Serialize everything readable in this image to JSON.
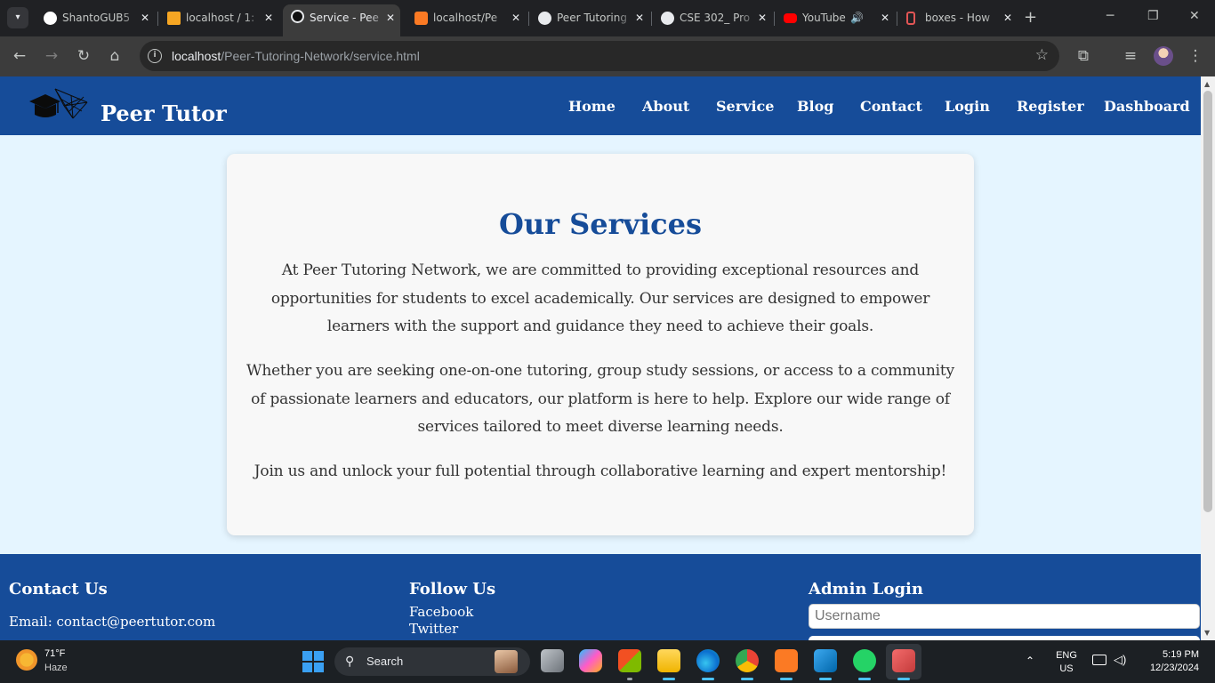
{
  "browser": {
    "tabs": [
      {
        "label": "ShantoGUB5",
        "icon": "github-icon",
        "color": "#ffffff",
        "active": false
      },
      {
        "label": "localhost / 1:",
        "icon": "phpmyadmin-icon",
        "color": "#f6a623",
        "active": false
      },
      {
        "label": "Service - Pee",
        "icon": "service-icon",
        "color": "#e8eaed",
        "active": true
      },
      {
        "label": "localhost/Pe",
        "icon": "xampp-icon",
        "color": "#fb7a24",
        "active": false
      },
      {
        "label": "Peer Tutoring",
        "icon": "openai-icon",
        "color": "#e8eaed",
        "active": false
      },
      {
        "label": "CSE 302_ Pro",
        "icon": "chatgpt-icon",
        "color": "#e8eaed",
        "active": false
      },
      {
        "label": "YouTube",
        "icon": "youtube-icon",
        "color": "#ff0000",
        "active": false
      },
      {
        "label": "boxes - How",
        "icon": "codepen-icon",
        "color": "#e25555",
        "active": false
      }
    ],
    "address": {
      "host": "localhost",
      "path": "/Peer-Tutoring-Network/service.html"
    }
  },
  "site": {
    "brand": "Peer Tutor",
    "nav": [
      "Home",
      "About",
      "Service",
      "Blog",
      "Contact",
      "Login",
      "Register",
      "Dashboard"
    ],
    "accent": "#164c99",
    "background": "#e5f5ff"
  },
  "services": {
    "title": "Our Services",
    "paragraphs": [
      "At Peer Tutoring Network, we are committed to providing exceptional resources and opportunities for students to excel academically. Our services are designed to empower learners with the support and guidance they need to achieve their goals.",
      "Whether you are seeking one-on-one tutoring, group study sessions, or access to a community of passionate learners and educators, our platform is here to help. Explore our wide range of services tailored to meet diverse learning needs.",
      "Join us and unlock your full potential through collaborative learning and expert mentorship!"
    ]
  },
  "footer": {
    "contact_heading": "Contact Us",
    "contact_email": "Email: contact@peertutor.com",
    "follow_heading": "Follow Us",
    "follow_links": [
      "Facebook",
      "Twitter"
    ],
    "admin_heading": "Admin Login",
    "username_placeholder": "Username"
  },
  "taskbar": {
    "weather_temp": "71°F",
    "weather_desc": "Haze",
    "search_label": "Search",
    "lang_top": "ENG",
    "lang_bottom": "US",
    "time": "5:19 PM",
    "date": "12/23/2024",
    "apps": [
      "task-view-icon",
      "copilot-icon",
      "store-icon",
      "file-explorer-icon",
      "edge-icon",
      "chrome-icon",
      "xampp-icon",
      "vscode-icon",
      "whatsapp-icon",
      "snipping-tool-icon"
    ]
  }
}
